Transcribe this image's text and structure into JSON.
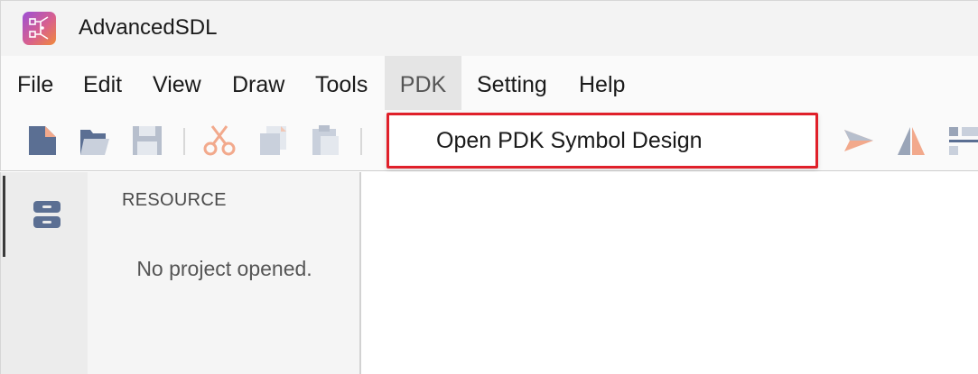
{
  "window": {
    "title": "AdvancedSDL",
    "app_icon": "app-logo-icon"
  },
  "menubar": {
    "items": [
      {
        "label": "File"
      },
      {
        "label": "Edit"
      },
      {
        "label": "View"
      },
      {
        "label": "Draw"
      },
      {
        "label": "Tools"
      },
      {
        "label": "PDK",
        "active": true
      },
      {
        "label": "Setting"
      },
      {
        "label": "Help"
      }
    ]
  },
  "dropdown": {
    "parent": "PDK",
    "items": [
      {
        "label": "Open PDK Symbol Design"
      }
    ],
    "highlight_color": "#e0202a"
  },
  "toolbar": {
    "icons": [
      "new-file-icon",
      "open-folder-icon",
      "save-icon",
      "cut-icon",
      "copy-icon",
      "paste-icon",
      "send-icon",
      "mirror-icon",
      "align-icon"
    ]
  },
  "sidebar": {
    "activity_icon": "resource-drawer-icon",
    "panel_title": "RESOURCE",
    "empty_text": "No project opened."
  },
  "colors": {
    "accent_blue": "#5b6f93",
    "accent_peach": "#f2a98c",
    "dropdown_border": "#e0202a"
  }
}
